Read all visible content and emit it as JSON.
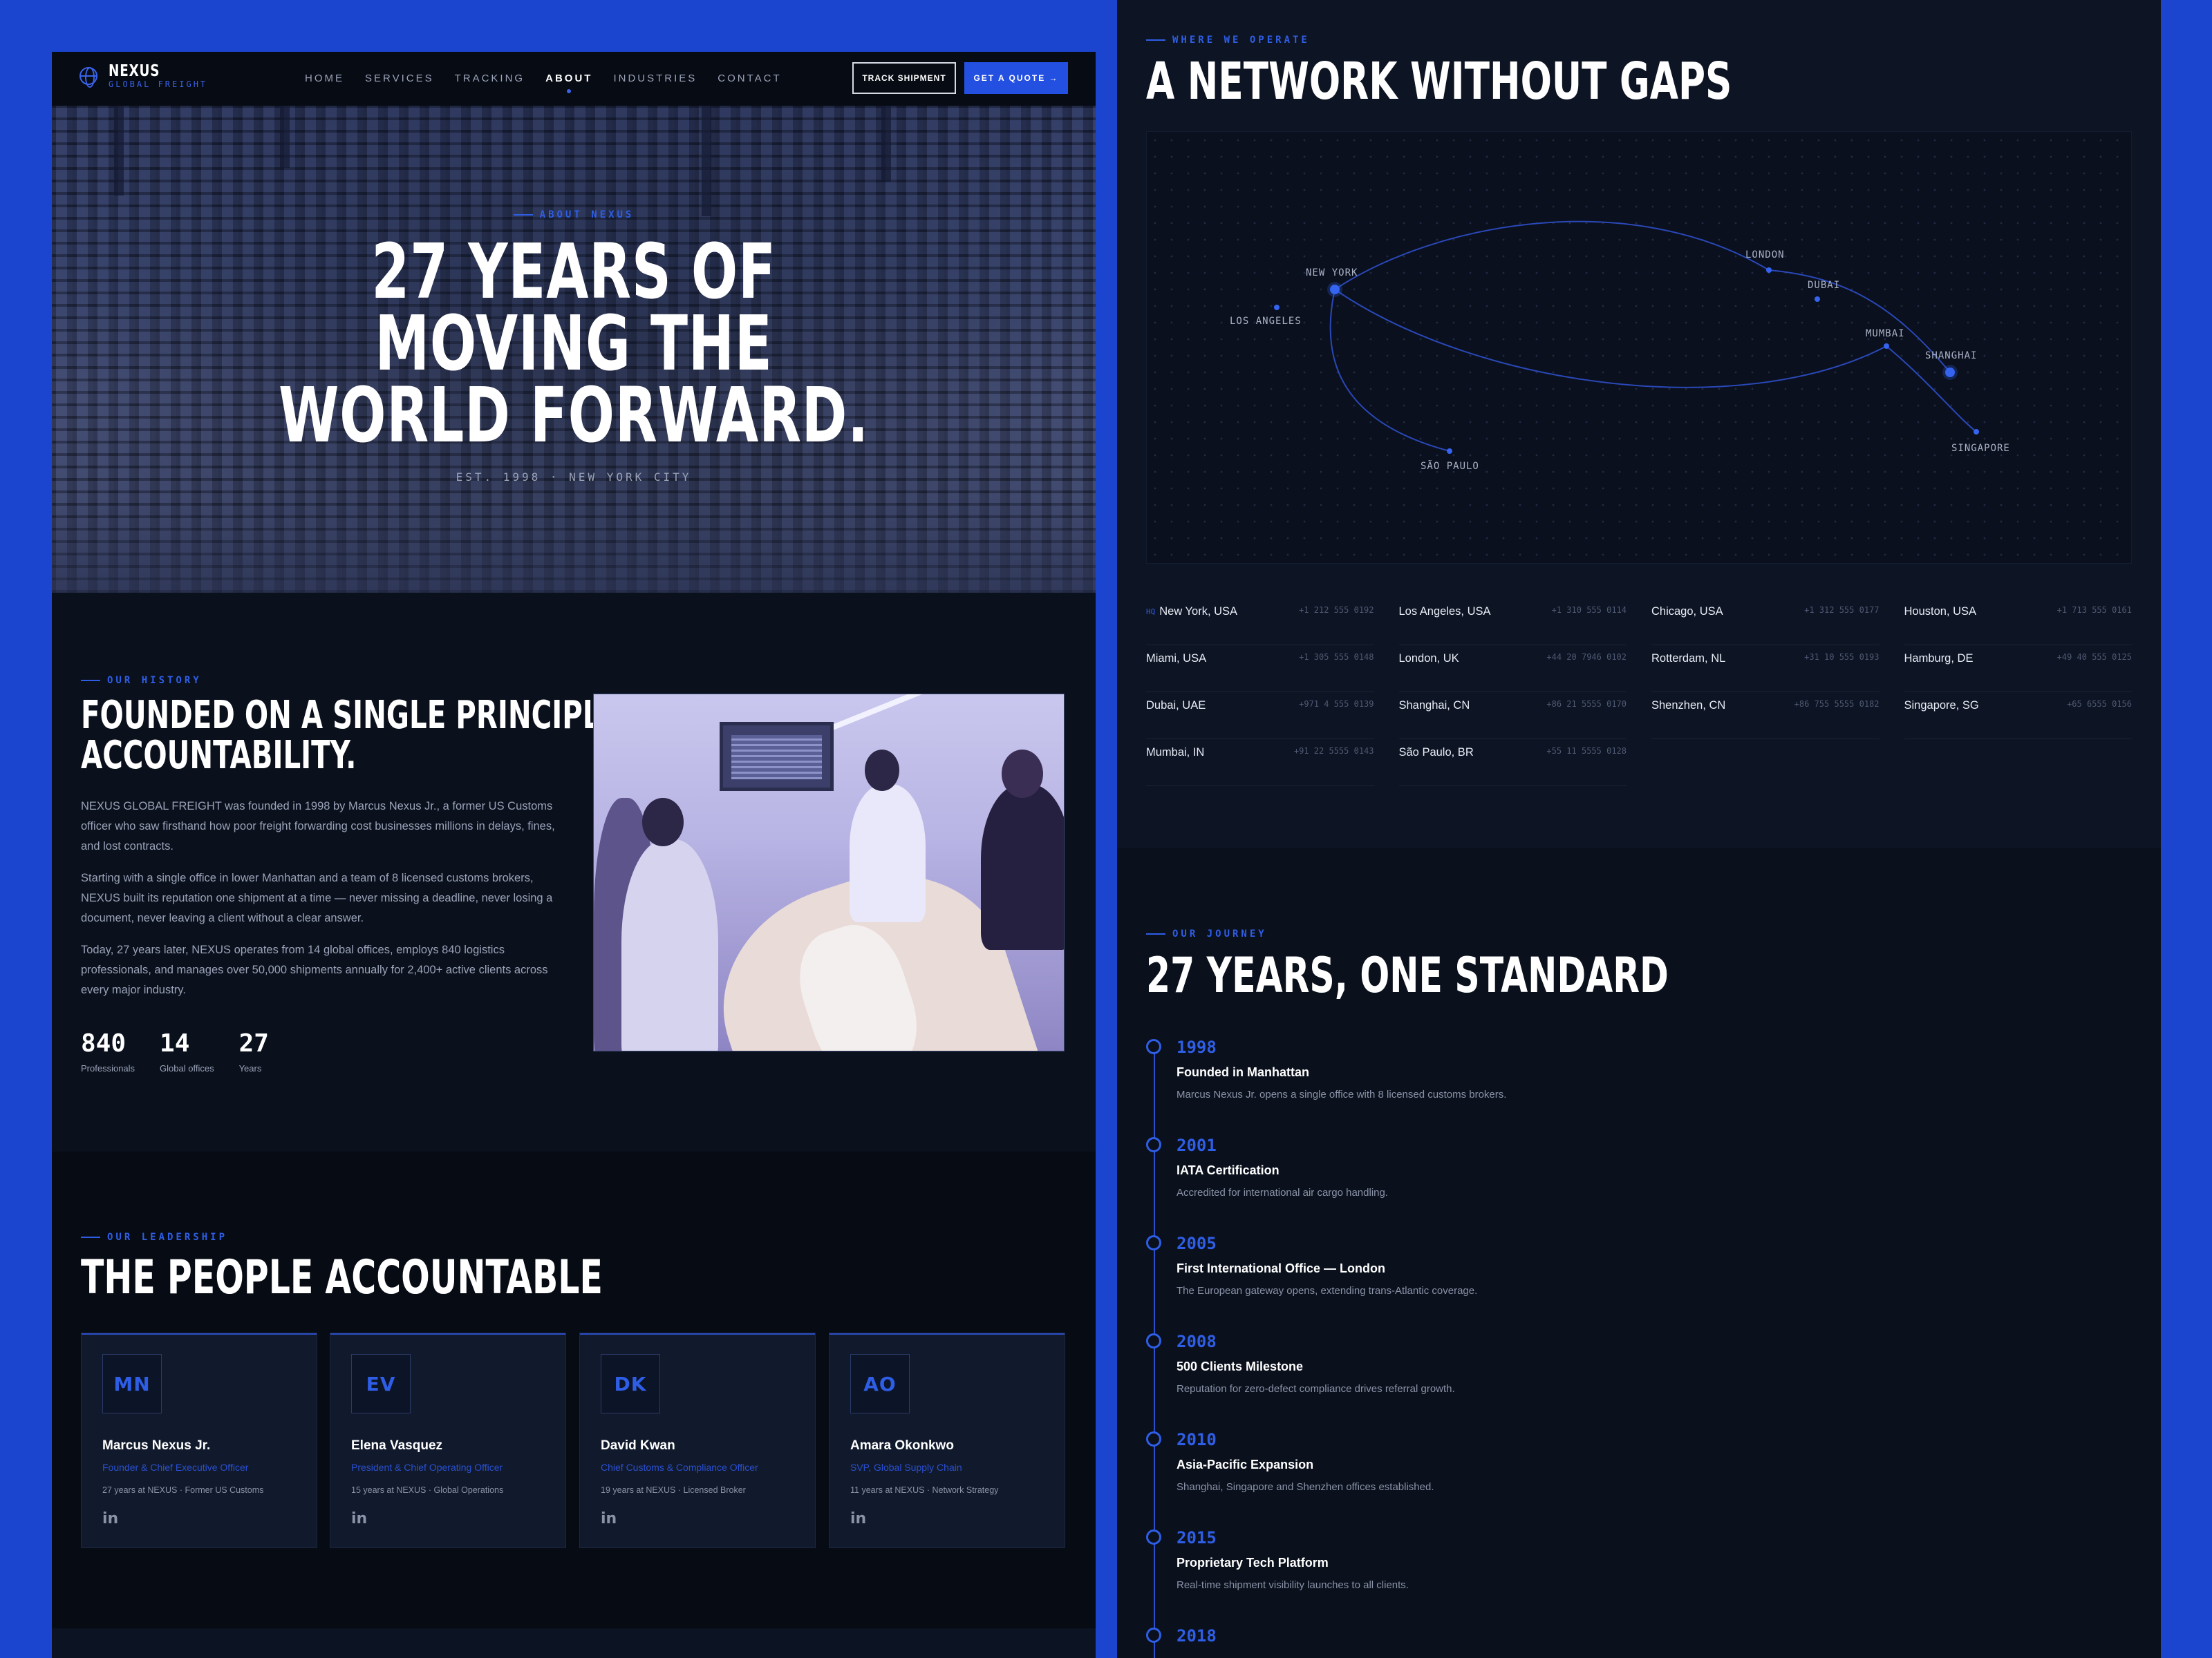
{
  "brand": {
    "name": "NEXUS",
    "sub": "GLOBAL FREIGHT"
  },
  "nav": {
    "items": [
      "HOME",
      "SERVICES",
      "TRACKING",
      "ABOUT",
      "INDUSTRIES",
      "CONTACT"
    ],
    "active": "ABOUT",
    "track_label": "TRACK SHIPMENT",
    "quote_label": "GET A QUOTE →"
  },
  "hero": {
    "eyebrow": "ABOUT NEXUS",
    "title_lines": [
      "27 YEARS OF",
      "MOVING THE",
      "WORLD FORWARD."
    ],
    "est": "EST. 1998 · NEW YORK CITY"
  },
  "history": {
    "eyebrow": "OUR HISTORY",
    "title_lines": [
      "FOUNDED ON A SINGLE PRINCIPLE:",
      "ACCOUNTABILITY."
    ],
    "paragraphs": [
      "NEXUS GLOBAL FREIGHT was founded in 1998 by Marcus Nexus Jr., a former US Customs officer who saw firsthand how poor freight forwarding cost businesses millions in delays, fines, and lost contracts.",
      "Starting with a single office in lower Manhattan and a team of 8 licensed customs brokers, NEXUS built its reputation one shipment at a time — never missing a deadline, never losing a document, never leaving a client without a clear answer.",
      "Today, 27 years later, NEXUS operates from 14 global offices, employs 840 logistics professionals, and manages over 50,000 shipments annually for 2,400+ active clients across every major industry."
    ],
    "stats": [
      {
        "value": "840",
        "label": "Professionals"
      },
      {
        "value": "14",
        "label": "Global offices"
      },
      {
        "value": "27",
        "label": "Years"
      }
    ]
  },
  "leadership": {
    "eyebrow": "OUR LEADERSHIP",
    "title": "THE PEOPLE ACCOUNTABLE",
    "people": [
      {
        "initials": "MN",
        "name": "Marcus Nexus Jr.",
        "role": "Founder & Chief Executive Officer",
        "meta": "27 years at NEXUS · Former US Customs",
        "social": "in"
      },
      {
        "initials": "EV",
        "name": "Elena Vasquez",
        "role": "President & Chief Operating Officer",
        "meta": "15 years at NEXUS · Global Operations",
        "social": "in"
      },
      {
        "initials": "DK",
        "name": "David Kwan",
        "role": "Chief Customs & Compliance Officer",
        "meta": "19 years at NEXUS · Licensed Broker",
        "social": "in"
      },
      {
        "initials": "AO",
        "name": "Amara Okonkwo",
        "role": "SVP, Global Supply Chain",
        "meta": "11 years at NEXUS · Network Strategy",
        "social": "in"
      }
    ]
  },
  "network": {
    "eyebrow": "WHERE WE OPERATE",
    "title": "A NETWORK WITHOUT GAPS",
    "map_cities": [
      {
        "name": "NEW YORK",
        "hub": true
      },
      {
        "name": "LOS ANGELES",
        "hub": false
      },
      {
        "name": "LONDON",
        "hub": false
      },
      {
        "name": "DUBAI",
        "hub": false
      },
      {
        "name": "MUMBAI",
        "hub": false
      },
      {
        "name": "SHANGHAI",
        "hub": true
      },
      {
        "name": "SINGAPORE",
        "hub": false
      },
      {
        "name": "SÃO PAULO",
        "hub": false
      }
    ],
    "offices": [
      {
        "flag": "HQ",
        "name": "New York, USA",
        "phone": "+1 212 555 0192"
      },
      {
        "flag": "",
        "name": "Los Angeles, USA",
        "phone": "+1 310 555 0114"
      },
      {
        "flag": "",
        "name": "Chicago, USA",
        "phone": "+1 312 555 0177"
      },
      {
        "flag": "",
        "name": "Houston, USA",
        "phone": "+1 713 555 0161"
      },
      {
        "flag": "",
        "name": "Miami, USA",
        "phone": "+1 305 555 0148"
      },
      {
        "flag": "",
        "name": "London, UK",
        "phone": "+44 20 7946 0102"
      },
      {
        "flag": "",
        "name": "Rotterdam, NL",
        "phone": "+31 10 555 0193"
      },
      {
        "flag": "",
        "name": "Hamburg, DE",
        "phone": "+49 40 555 0125"
      },
      {
        "flag": "",
        "name": "Dubai, UAE",
        "phone": "+971 4 555 0139"
      },
      {
        "flag": "",
        "name": "Shanghai, CN",
        "phone": "+86 21 5555 0170"
      },
      {
        "flag": "",
        "name": "Shenzhen, CN",
        "phone": "+86 755 5555 0182"
      },
      {
        "flag": "",
        "name": "Singapore, SG",
        "phone": "+65 6555 0156"
      },
      {
        "flag": "",
        "name": "Mumbai, IN",
        "phone": "+91 22 5555 0143"
      },
      {
        "flag": "",
        "name": "São Paulo, BR",
        "phone": "+55 11 5555 0128"
      }
    ]
  },
  "journey": {
    "eyebrow": "OUR JOURNEY",
    "title": "27 YEARS, ONE STANDARD",
    "milestones": [
      {
        "year": "1998",
        "title": "Founded in Manhattan",
        "desc": "Marcus Nexus Jr. opens a single office with 8 licensed customs brokers."
      },
      {
        "year": "2001",
        "title": "IATA Certification",
        "desc": "Accredited for international air cargo handling."
      },
      {
        "year": "2005",
        "title": "First International Office — London",
        "desc": "The European gateway opens, extending trans-Atlantic coverage."
      },
      {
        "year": "2008",
        "title": "500 Clients Milestone",
        "desc": "Reputation for zero-defect compliance drives referral growth."
      },
      {
        "year": "2010",
        "title": "Asia-Pacific Expansion",
        "desc": "Shanghai, Singapore and Shenzhen offices established."
      },
      {
        "year": "2015",
        "title": "Proprietary Tech Platform",
        "desc": "Real-time shipment visibility launches to all clients."
      },
      {
        "year": "2018",
        "title": "",
        "desc": ""
      }
    ]
  },
  "colors": {
    "accent": "#2450e2",
    "bg": "#0a101c",
    "frame": "#1c45cf"
  }
}
